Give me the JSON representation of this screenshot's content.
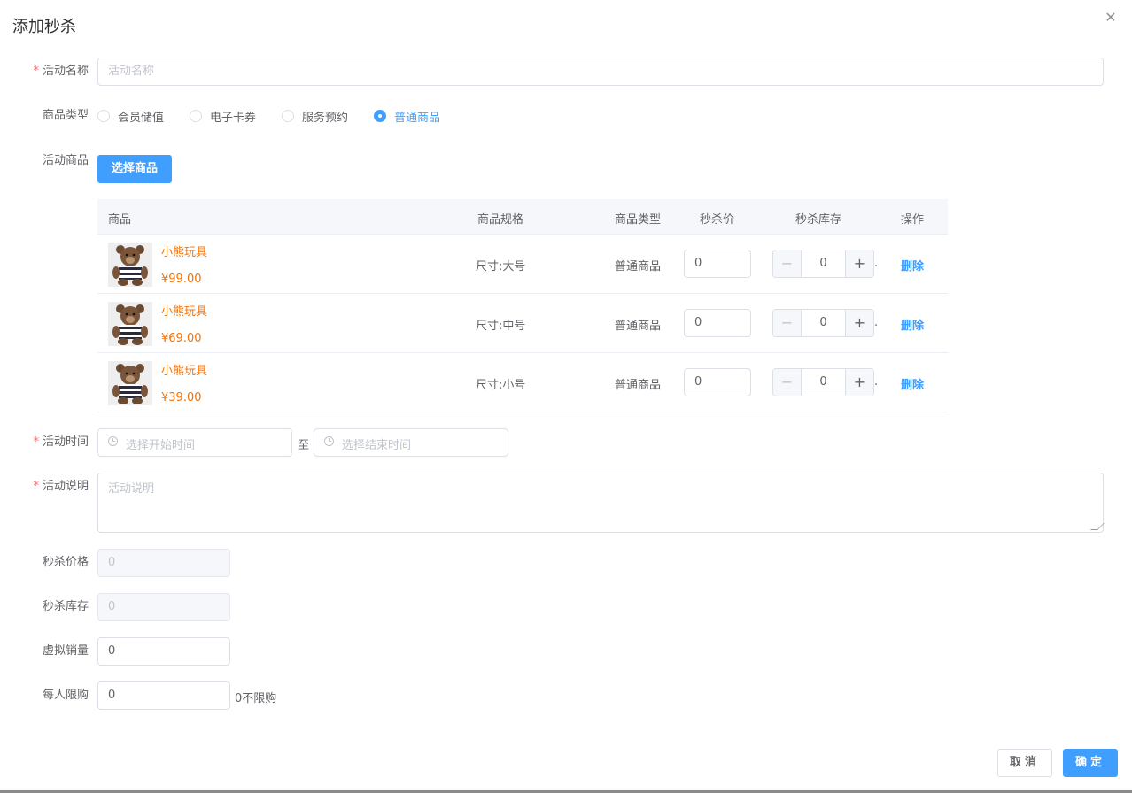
{
  "dialog": {
    "title": "添加秒杀",
    "close_icon": "close-icon"
  },
  "form": {
    "required_mark": "*",
    "activity_name": {
      "label": "活动名称",
      "placeholder": "活动名称",
      "value": ""
    },
    "product_type": {
      "label": "商品类型",
      "options": [
        "会员储值",
        "电子卡券",
        "服务预约",
        "普通商品"
      ],
      "selected": "普通商品"
    },
    "activity_goods": {
      "label": "活动商品",
      "select_button": "选择商品"
    },
    "activity_time": {
      "label": "活动时间",
      "start_placeholder": "选择开始时间",
      "separator": "至",
      "end_placeholder": "选择结束时间"
    },
    "activity_desc": {
      "label": "活动说明",
      "placeholder": "活动说明"
    },
    "seckill_price": {
      "label": "秒杀价格",
      "value": "0"
    },
    "seckill_stock": {
      "label": "秒杀库存",
      "value": "0"
    },
    "virtual_sales": {
      "label": "虚拟销量",
      "value": "0"
    },
    "limit_per_person": {
      "label": "每人限购",
      "value": "0",
      "hint": "0不限购"
    }
  },
  "table": {
    "headers": [
      "商品",
      "商品规格",
      "商品类型",
      "秒杀价",
      "秒杀库存",
      "操作"
    ],
    "rows": [
      {
        "name": "小熊玩具",
        "price": "¥99.00",
        "spec": "尺寸:大号",
        "type": "普通商品",
        "seckill_price": "0",
        "stock": "0",
        "action": "删除"
      },
      {
        "name": "小熊玩具",
        "price": "¥69.00",
        "spec": "尺寸:中号",
        "type": "普通商品",
        "seckill_price": "0",
        "stock": "0",
        "action": "删除"
      },
      {
        "name": "小熊玩具",
        "price": "¥39.00",
        "spec": "尺寸:小号",
        "type": "普通商品",
        "seckill_price": "0",
        "stock": "0",
        "action": "删除"
      }
    ],
    "stepper_minus": "−",
    "stepper_plus": "+",
    "dot": "."
  },
  "footer": {
    "cancel": "取消",
    "confirm": "确定"
  },
  "colors": {
    "primary": "#409eff",
    "price": "#f0730c",
    "required": "#f56c6c"
  }
}
